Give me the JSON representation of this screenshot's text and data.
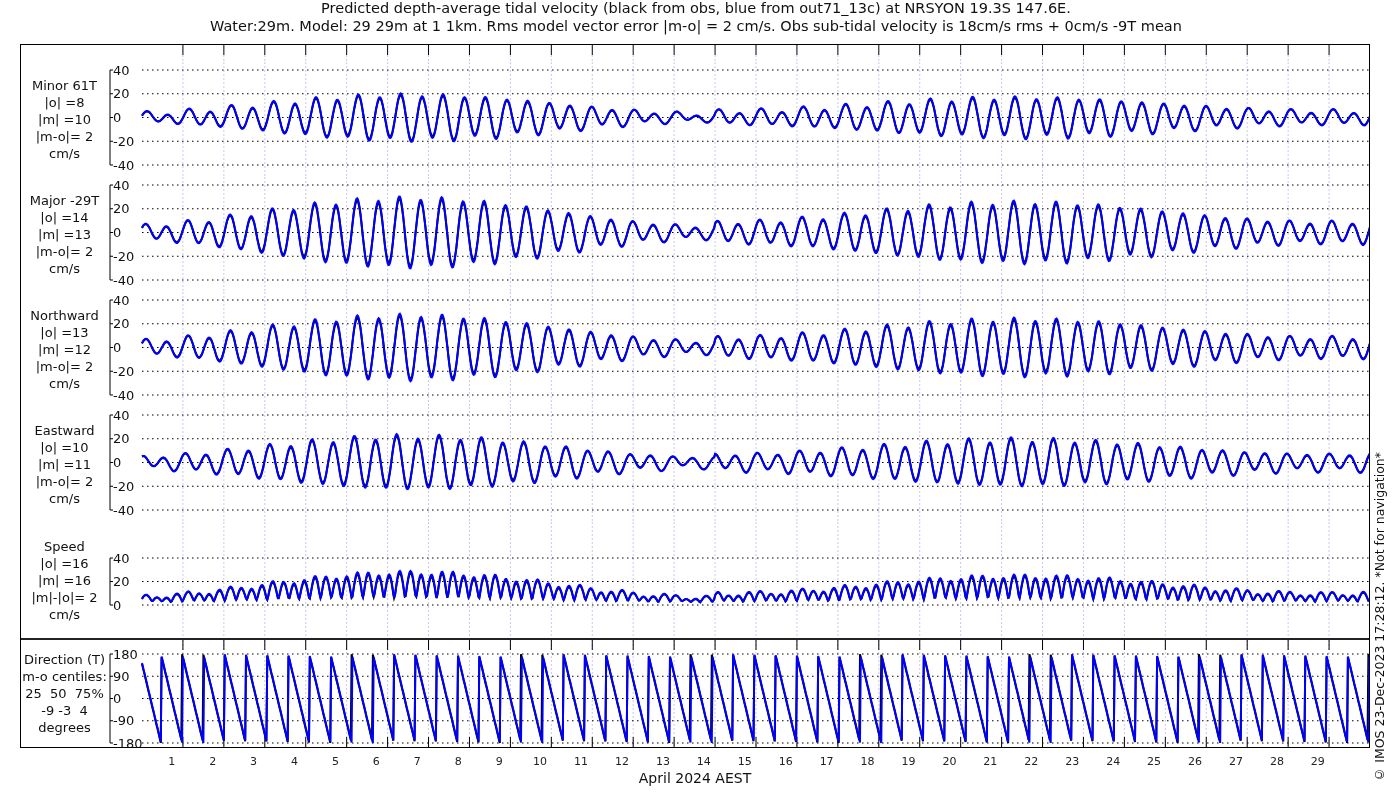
{
  "title_lines": [
    "Predicted depth-average tidal velocity (black from obs, blue from out71_13c) at NRSYON 19.3S 147.6E.",
    "Water:29m. Model: 29 29m at 1 1km. Rms model vector error |m-o| = 2 cm/s. Obs sub-tidal velocity is 18cm/s rms + 0cm/s -9T mean"
  ],
  "panels": [
    {
      "kind": "minor",
      "label_lines": [
        "Minor 61T",
        "|o| =8",
        "|m| =10",
        "|m-o|= 2",
        "cm/s"
      ],
      "yticks": [
        "40",
        "20",
        "0",
        "-20",
        "-40"
      ]
    },
    {
      "kind": "major",
      "label_lines": [
        "Major -29T",
        "|o| =14",
        "|m| =13",
        "|m-o|= 2",
        "cm/s"
      ],
      "yticks": [
        "40",
        "20",
        "0",
        "-20",
        "-40"
      ]
    },
    {
      "kind": "north",
      "label_lines": [
        "Northward",
        "|o| =13",
        "|m| =12",
        "|m-o|= 2",
        "cm/s"
      ],
      "yticks": [
        "40",
        "20",
        "0",
        "-20",
        "-40"
      ]
    },
    {
      "kind": "east",
      "label_lines": [
        "Eastward",
        "|o| =10",
        "|m| =11",
        "|m-o|= 2",
        "cm/s"
      ],
      "yticks": [
        "40",
        "20",
        "0",
        "-20",
        "-40"
      ]
    },
    {
      "kind": "speed",
      "label_lines": [
        "Speed",
        "|o| =16",
        "|m| =16",
        "|m|-|o|= 2",
        "cm/s"
      ],
      "yticks": [
        "40",
        "20",
        "0"
      ]
    },
    {
      "kind": "direction",
      "label_lines": [
        "Direction (T)",
        "m-o centiles:",
        "25  50  75%",
        "-9 -3  4",
        "degrees"
      ],
      "yticks": [
        "180",
        "90",
        "0",
        "-90",
        "-180"
      ]
    }
  ],
  "xticks": [
    "1",
    "2",
    "3",
    "4",
    "5",
    "6",
    "7",
    "8",
    "9",
    "10",
    "11",
    "12",
    "13",
    "14",
    "15",
    "16",
    "17",
    "18",
    "19",
    "20",
    "21",
    "22",
    "23",
    "24",
    "25",
    "26",
    "27",
    "28",
    "29"
  ],
  "xlabel": "April 2024 AEST",
  "side_note": "© IMOS 23-Dec-2023 17:28:12. *Not for navigation*"
}
